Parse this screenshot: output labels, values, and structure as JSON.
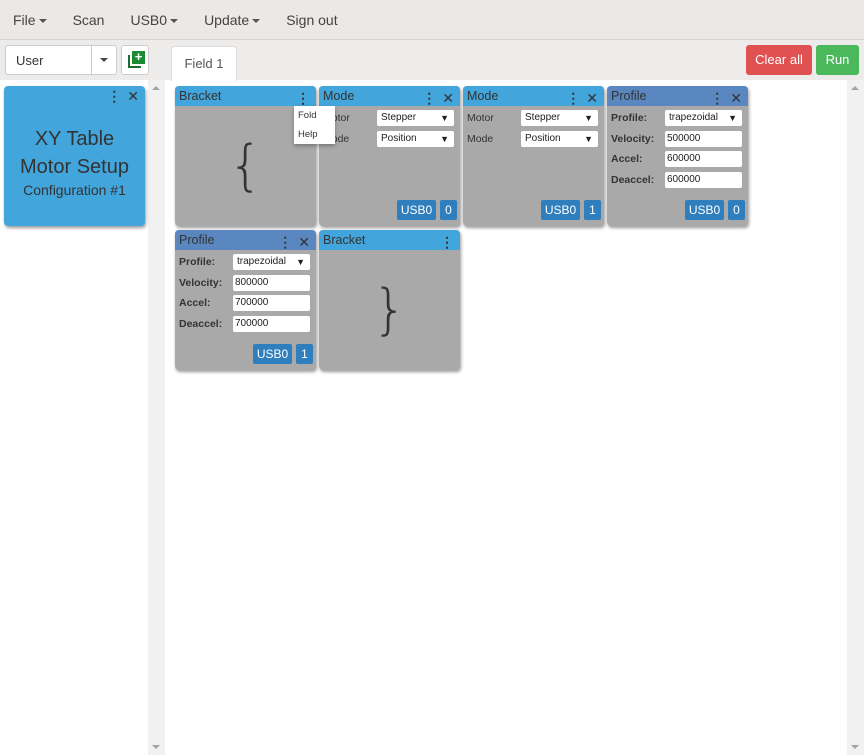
{
  "menubar": {
    "items": [
      {
        "label": "File",
        "caret": true
      },
      {
        "label": "Scan",
        "caret": false
      },
      {
        "label": "USB0",
        "caret": true
      },
      {
        "label": "Update",
        "caret": true
      },
      {
        "label": "Sign out",
        "caret": false
      }
    ]
  },
  "toolbar": {
    "user_select": "User",
    "tab": "Field 1",
    "clear_label": "Clear all",
    "run_label": "Run",
    "add_icon": "add-layer-icon"
  },
  "colors": {
    "blue_header": "#42a5dc",
    "profile_header": "#5a87c0",
    "card_body": "#a9a9a9",
    "badge": "#2f7fbf",
    "clear": "#e05151",
    "run": "#4cb85c"
  },
  "main_card": {
    "line1": "XY Table",
    "line2": "Motor Setup",
    "line3": "Configuration #1"
  },
  "popup_menu": {
    "items": [
      "Fold",
      "Help"
    ]
  },
  "cards": [
    {
      "type": "bracket",
      "title": "Bracket",
      "symbol": "{",
      "closable": false
    },
    {
      "type": "mode",
      "title": "Mode",
      "closable": true,
      "fields": [
        {
          "label": "Motor",
          "value": "Stepper"
        },
        {
          "label": "Mode",
          "value": "Position"
        }
      ],
      "port": "USB0",
      "index": "0"
    },
    {
      "type": "mode",
      "title": "Mode",
      "closable": true,
      "fields": [
        {
          "label": "Motor",
          "value": "Stepper"
        },
        {
          "label": "Mode",
          "value": "Position"
        }
      ],
      "port": "USB0",
      "index": "1"
    },
    {
      "type": "profile",
      "title": "Profile",
      "closable": true,
      "fields": [
        {
          "label": "Profile:",
          "value": "trapezoidal",
          "select": true
        },
        {
          "label": "Velocity:",
          "value": "500000"
        },
        {
          "label": "Accel:",
          "value": "600000"
        },
        {
          "label": "Deaccel:",
          "value": "600000"
        }
      ],
      "port": "USB0",
      "index": "0"
    },
    {
      "type": "profile",
      "title": "Profile",
      "closable": true,
      "fields": [
        {
          "label": "Profile:",
          "value": "trapezoidal",
          "select": true
        },
        {
          "label": "Velocity:",
          "value": "800000"
        },
        {
          "label": "Accel:",
          "value": "700000"
        },
        {
          "label": "Deaccel:",
          "value": "700000"
        }
      ],
      "port": "USB0",
      "index": "1"
    },
    {
      "type": "bracket",
      "title": "Bracket",
      "symbol": "}",
      "closable": false
    }
  ]
}
